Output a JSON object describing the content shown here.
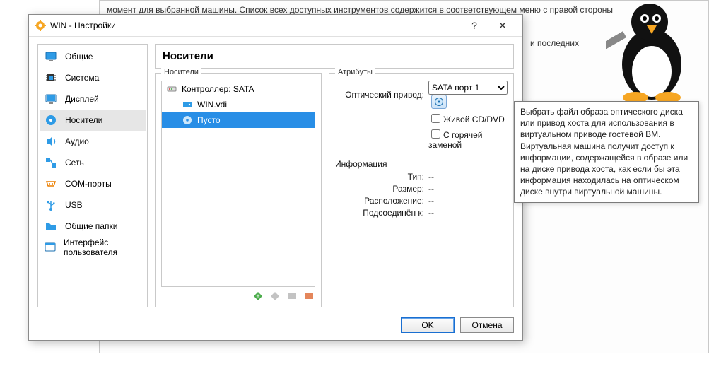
{
  "bg": {
    "line": "момент для выбранной машины. Список всех доступных инструментов содержится в соответствующем меню с правой стороны",
    "frag": "и последних"
  },
  "dialog": {
    "title": "WIN - Настройки",
    "help": "?",
    "close": "✕"
  },
  "sidebar": {
    "items": [
      {
        "label": "Общие"
      },
      {
        "label": "Система"
      },
      {
        "label": "Дисплей"
      },
      {
        "label": "Носители"
      },
      {
        "label": "Аудио"
      },
      {
        "label": "Сеть"
      },
      {
        "label": "COM-порты"
      },
      {
        "label": "USB"
      },
      {
        "label": "Общие папки"
      },
      {
        "label": "Интерфейс пользователя"
      }
    ]
  },
  "main": {
    "heading": "Носители",
    "storage_legend": "Носители",
    "attrs_legend": "Атрибуты",
    "tree": {
      "controller": "Контроллер: SATA",
      "vdi": "WIN.vdi",
      "empty": "Пусто"
    },
    "attrs": {
      "drive_label": "Оптический привод:",
      "port": "SATA порт 1",
      "live_cd": "Живой CD/DVD",
      "hot_swap": "С горячей заменой"
    },
    "info": {
      "heading": "Информация",
      "type_label": "Тип:",
      "type_val": "--",
      "size_label": "Размер:",
      "size_val": "--",
      "loc_label": "Расположение:",
      "loc_val": "--",
      "conn_label": "Подсоединён к:",
      "conn_val": "--"
    }
  },
  "footer": {
    "ok": "OK",
    "cancel": "Отмена"
  },
  "tooltip": "Выбрать файл образа оптического диска или привод хоста для использования в виртуальном приводе гостевой ВМ. Виртуальная машина получит доступ к информации, содержащейся в образе или на диске привода хоста, как если бы эта информация находилась на оптическом диске внутри виртуальной машины."
}
